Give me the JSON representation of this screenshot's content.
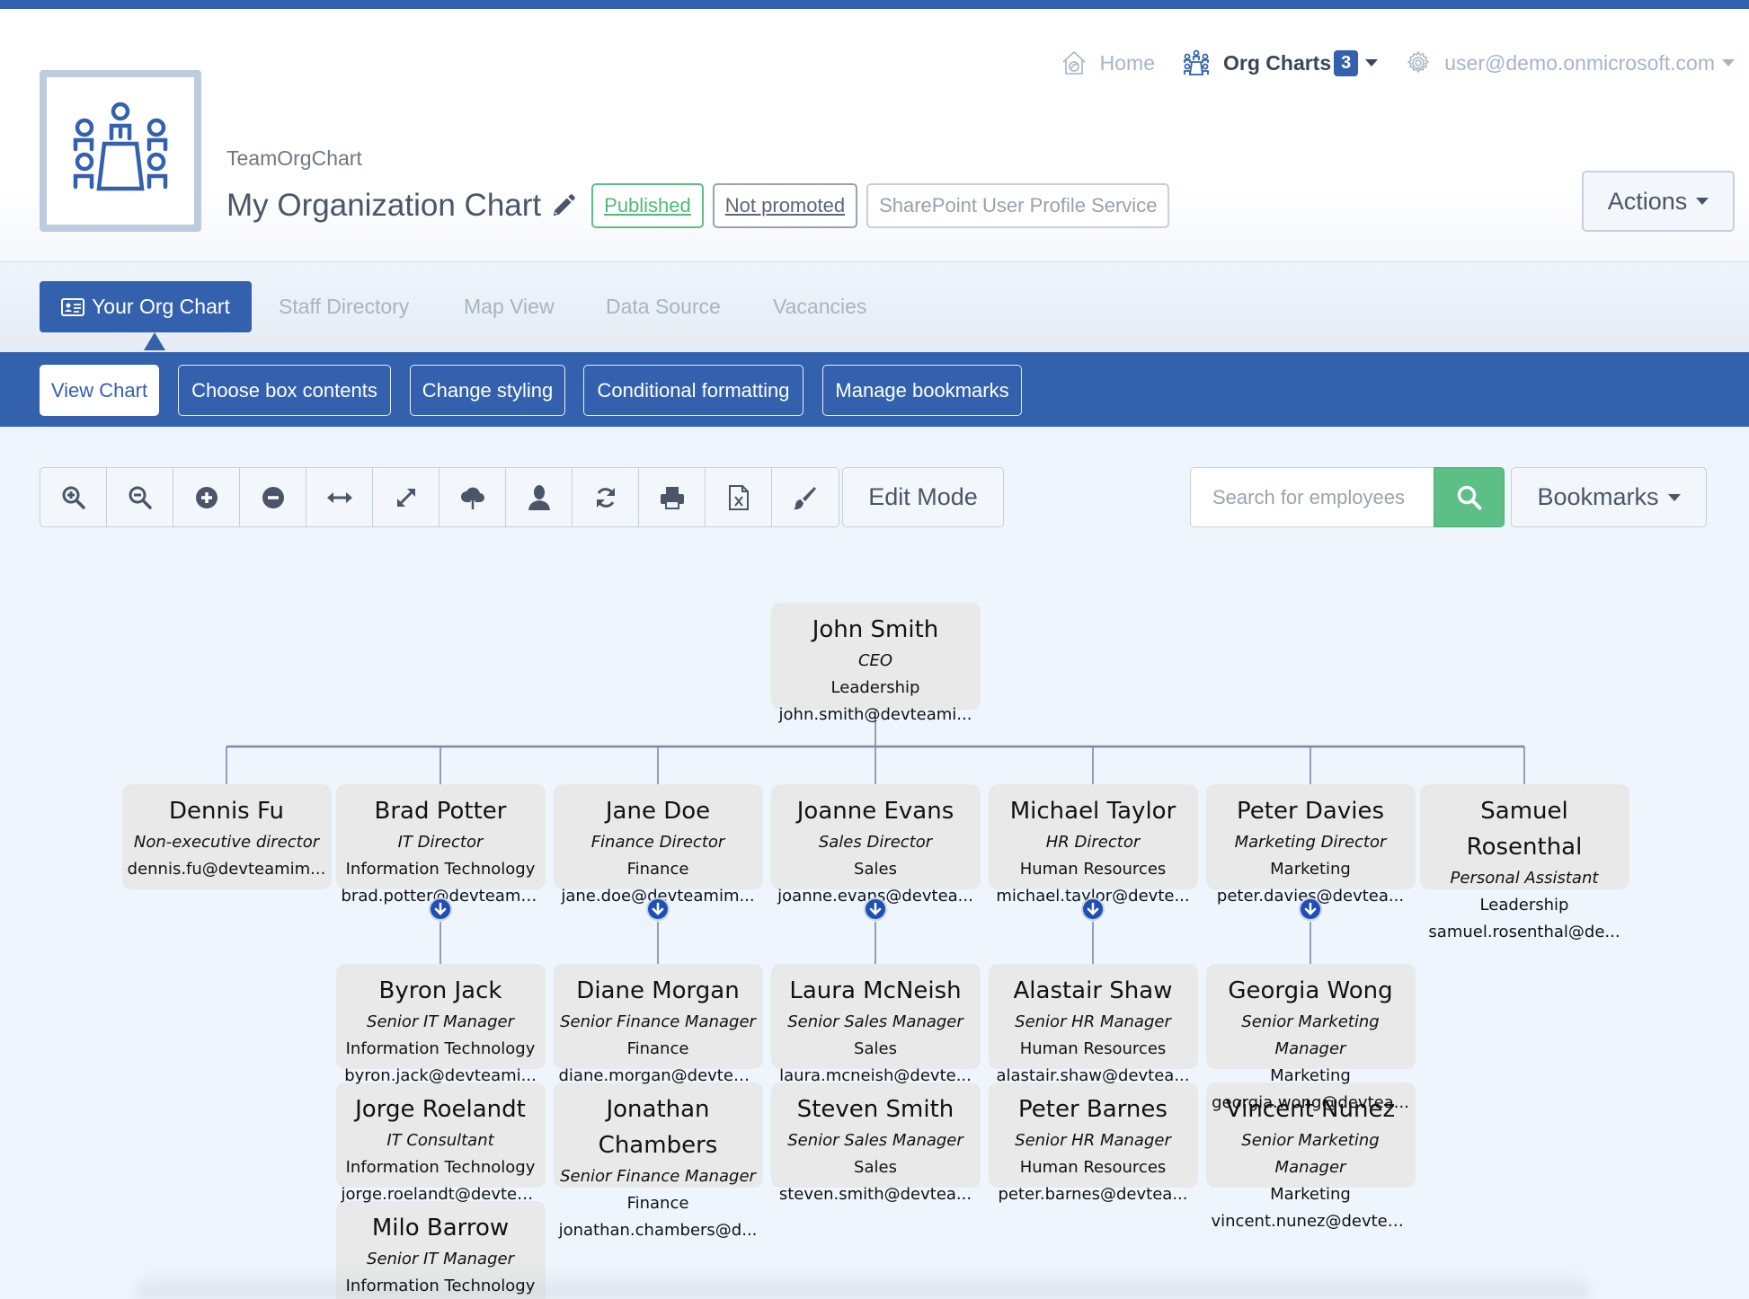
{
  "header": {
    "brand": "TeamOrgChart",
    "title": "My Organization Chart",
    "badges": {
      "published": "Published",
      "not_promoted": "Not promoted",
      "source": "SharePoint User Profile Service"
    },
    "actions_label": "Actions"
  },
  "topnav": {
    "home": "Home",
    "org_charts": "Org Charts",
    "org_charts_count": "3",
    "user": "user@demo.onmicrosoft.com"
  },
  "tabs": [
    {
      "label": "Your Org Chart",
      "active": true
    },
    {
      "label": "Staff Directory"
    },
    {
      "label": "Map View"
    },
    {
      "label": "Data Source"
    },
    {
      "label": "Vacancies"
    }
  ],
  "subtabs": [
    {
      "label": "View Chart",
      "active": true
    },
    {
      "label": "Choose box contents"
    },
    {
      "label": "Change styling"
    },
    {
      "label": "Conditional formatting"
    },
    {
      "label": "Manage bookmarks"
    }
  ],
  "toolbar": {
    "tools": [
      "zoom-in",
      "zoom-out",
      "expand-all",
      "collapse-all",
      "fit-width",
      "fullscreen",
      "upload",
      "user",
      "refresh",
      "print",
      "export-excel",
      "styling-brush"
    ],
    "edit_mode": "Edit Mode",
    "search_placeholder": "Search for employees",
    "search_value": "",
    "bookmarks": "Bookmarks"
  },
  "colors": {
    "brand_blue": "#3361ad",
    "green": "#5cbf85",
    "node_bg": "#e9e9e9",
    "connector": "#7b8ba3",
    "expand_btn": "#1f4fb5"
  },
  "org": {
    "root": {
      "name": "John Smith",
      "title": "CEO",
      "dept": "Leadership",
      "email": "john.smith@devteami..."
    },
    "level2": [
      {
        "name": "Dennis Fu",
        "title": "Non-executive director",
        "dept": "",
        "email": "dennis.fu@devteamim...",
        "expandable": false
      },
      {
        "name": "Brad Potter",
        "title": "IT Director",
        "dept": "Information Technology",
        "email": "brad.potter@devteami...",
        "expandable": true
      },
      {
        "name": "Jane Doe",
        "title": "Finance Director",
        "dept": "Finance",
        "email": "jane.doe@devteamim...",
        "expandable": true
      },
      {
        "name": "Joanne Evans",
        "title": "Sales Director",
        "dept": "Sales",
        "email": "joanne.evans@devtea...",
        "expandable": true
      },
      {
        "name": "Michael Taylor",
        "title": "HR Director",
        "dept": "Human Resources",
        "email": "michael.taylor@devte...",
        "expandable": true
      },
      {
        "name": "Peter Davies",
        "title": "Marketing Director",
        "dept": "Marketing",
        "email": "peter.davies@devtea...",
        "expandable": true
      },
      {
        "name": "Samuel Rosenthal",
        "title": "Personal Assistant",
        "dept": "Leadership",
        "email": "samuel.rosenthal@de...",
        "expandable": false
      }
    ],
    "level3": [
      [
        {
          "name": "Byron Jack",
          "title": "Senior IT Manager",
          "dept": "Information Technology",
          "email": "byron.jack@devteami..."
        },
        {
          "name": "Jorge Roelandt",
          "title": "IT Consultant",
          "dept": "Information Technology",
          "email": "jorge.roelandt@devtea..."
        },
        {
          "name": "Milo Barrow",
          "title": "Senior IT Manager",
          "dept": "Information Technology",
          "email": ""
        }
      ],
      [
        {
          "name": "Diane Morgan",
          "title": "Senior Finance Manager",
          "dept": "Finance",
          "email": "diane.morgan@devtea..."
        },
        {
          "name": "Jonathan Chambers",
          "title": "Senior Finance Manager",
          "dept": "Finance",
          "email": "jonathan.chambers@d..."
        }
      ],
      [
        {
          "name": "Laura McNeish",
          "title": "Senior Sales Manager",
          "dept": "Sales",
          "email": "laura.mcneish@devte..."
        },
        {
          "name": "Steven Smith",
          "title": "Senior Sales Manager",
          "dept": "Sales",
          "email": "steven.smith@devtea..."
        }
      ],
      [
        {
          "name": "Alastair Shaw",
          "title": "Senior HR Manager",
          "dept": "Human Resources",
          "email": "alastair.shaw@devtea..."
        },
        {
          "name": "Peter Barnes",
          "title": "Senior HR Manager",
          "dept": "Human Resources",
          "email": "peter.barnes@devtea..."
        }
      ],
      [
        {
          "name": "Georgia Wong",
          "title": "Senior Marketing Manager",
          "dept": "Marketing",
          "email": "georgia.wong@devtea..."
        },
        {
          "name": "Vincent Nunez",
          "title": "Senior Marketing Manager",
          "dept": "Marketing",
          "email": "vincent.nunez@devtea..."
        }
      ]
    ]
  }
}
